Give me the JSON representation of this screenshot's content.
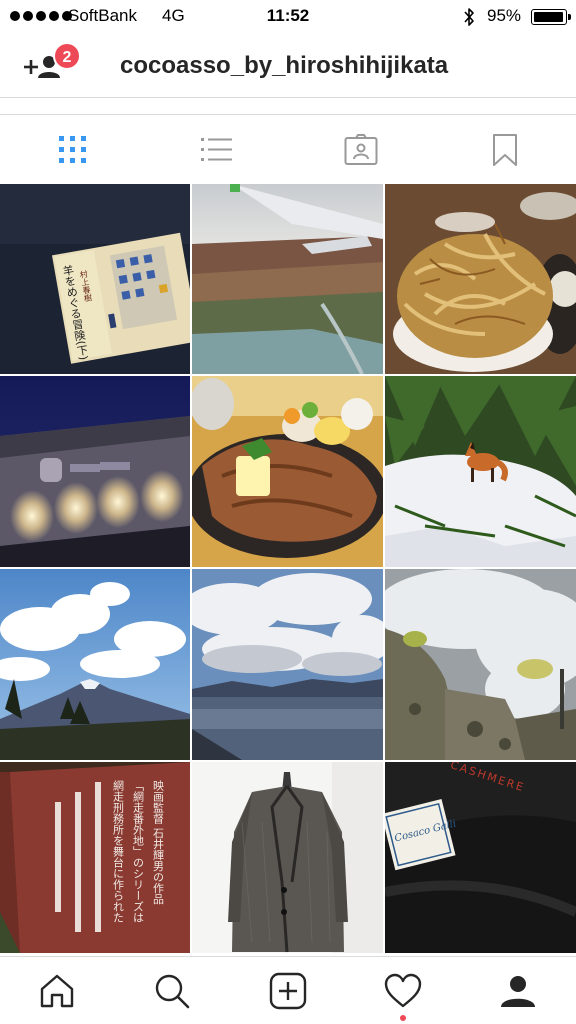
{
  "status_bar": {
    "carrier": "SoftBank",
    "network": "4G",
    "time": "11:52",
    "battery_percent": "95%",
    "battery_level": 0.95
  },
  "header": {
    "username": "cocoasso_by_hiroshihijikata",
    "add_friend_icon": "add-person-icon",
    "notification_count": "2",
    "badge_color": "#ed4956"
  },
  "view_tabs": [
    {
      "name": "grid",
      "icon": "grid-icon",
      "active": true,
      "color": "#3897f0"
    },
    {
      "name": "list",
      "icon": "list-icon",
      "active": false
    },
    {
      "name": "tagged",
      "icon": "tagged-icon",
      "active": false
    },
    {
      "name": "saved",
      "icon": "bookmark-icon",
      "active": false
    }
  ],
  "photos": [
    {
      "subject": "book"
    },
    {
      "subject": "airplane-view"
    },
    {
      "subject": "tempura-bowl"
    },
    {
      "subject": "sign-lights"
    },
    {
      "subject": "steak-plate"
    },
    {
      "subject": "fox-in-snow"
    },
    {
      "subject": "volcano-sky"
    },
    {
      "subject": "lake-clouds"
    },
    {
      "subject": "steaming-rocks"
    },
    {
      "subject": "monument-stone"
    },
    {
      "subject": "tweed-coat"
    },
    {
      "subject": "cashmere-fabric"
    }
  ],
  "photo_text": {
    "book_title": "羊をめぐる冒険(下)",
    "book_author": "村上春樹",
    "monument_line1": "映画監督 石井輝男の作品",
    "monument_line2": "「網走番外地」のシリーズは",
    "monument_line3": "網走刑務所を舞台に作られた",
    "fabric_label": "Cosaco Galli",
    "fabric_text": "CASHMERE"
  },
  "bottom_nav": [
    {
      "name": "home",
      "icon": "home-icon"
    },
    {
      "name": "search",
      "icon": "search-icon"
    },
    {
      "name": "add",
      "icon": "add-post-icon"
    },
    {
      "name": "activity",
      "icon": "heart-icon",
      "has_dot": true
    },
    {
      "name": "profile",
      "icon": "profile-icon",
      "active": true
    }
  ]
}
